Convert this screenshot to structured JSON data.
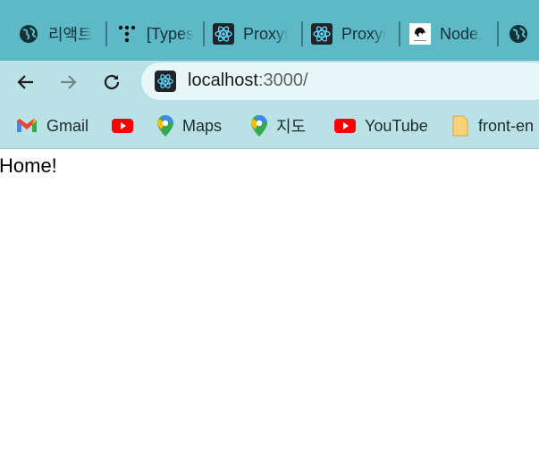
{
  "tabs": [
    {
      "icon": "globe-icon",
      "title": "리액트"
    },
    {
      "icon": "dots-logo-icon",
      "title": "[Types"
    },
    {
      "icon": "react-logo-icon",
      "title": "Proxyi"
    },
    {
      "icon": "react-logo-icon",
      "title": "Proxyi"
    },
    {
      "icon": "node-logo-icon",
      "title": "Node."
    },
    {
      "icon": "globe-icon",
      "title": ""
    }
  ],
  "address_bar": {
    "host": "localhost",
    "path": ":3000/"
  },
  "bookmarks": [
    {
      "icon": "gmail-icon",
      "label": "Gmail"
    },
    {
      "icon": "youtube-icon",
      "label": ""
    },
    {
      "icon": "maps-pin-icon",
      "label": "Maps"
    },
    {
      "icon": "maps-pin-icon",
      "label": "지도"
    },
    {
      "icon": "youtube-icon",
      "label": "YouTube"
    },
    {
      "icon": "folder-icon",
      "label": "front-en"
    }
  ],
  "page": {
    "text": "Home!"
  },
  "colors": {
    "tabbar": "#5eb9c6",
    "toolbar": "#b9e1e6",
    "omnibox": "#e9f6f7"
  }
}
